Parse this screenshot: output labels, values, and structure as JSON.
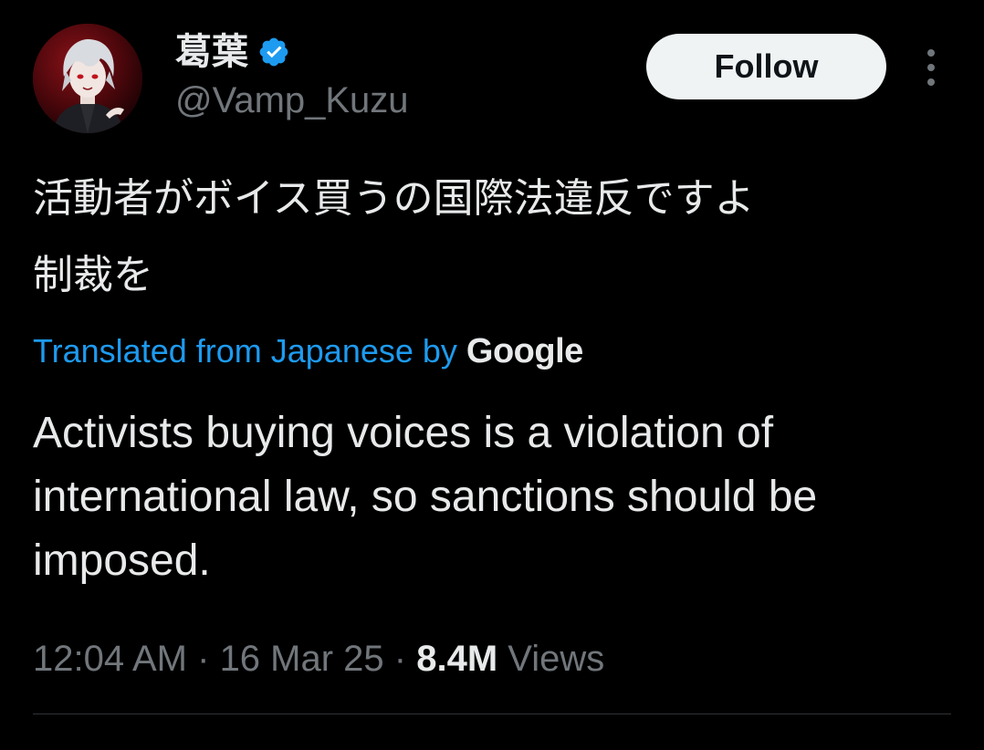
{
  "author": {
    "display_name": "葛葉",
    "handle": "@Vamp_Kuzu",
    "verified": true
  },
  "actions": {
    "follow_label": "Follow"
  },
  "tweet": {
    "text_line1": "活動者がボイス買うの国際法違反ですよ",
    "text_line2": "制裁を",
    "translated_label": "Translated from Japanese by",
    "translator_brand": "Google",
    "translation": "Activists buying voices is a violation of international law, so sanctions should be imposed."
  },
  "meta": {
    "time": "12:04 AM",
    "separator": " · ",
    "date": "16 Mar 25",
    "views_count": "8.4M",
    "views_label": "Views"
  },
  "colors": {
    "background": "#000000",
    "text_primary": "#e7e9ea",
    "text_secondary": "#71767b",
    "link": "#1d9bf0",
    "verified": "#1d9bf0",
    "follow_bg": "#eff3f4",
    "divider": "#2f3336"
  },
  "icons": {
    "verified": "verified-badge-icon",
    "more": "more-vertical-icon"
  }
}
